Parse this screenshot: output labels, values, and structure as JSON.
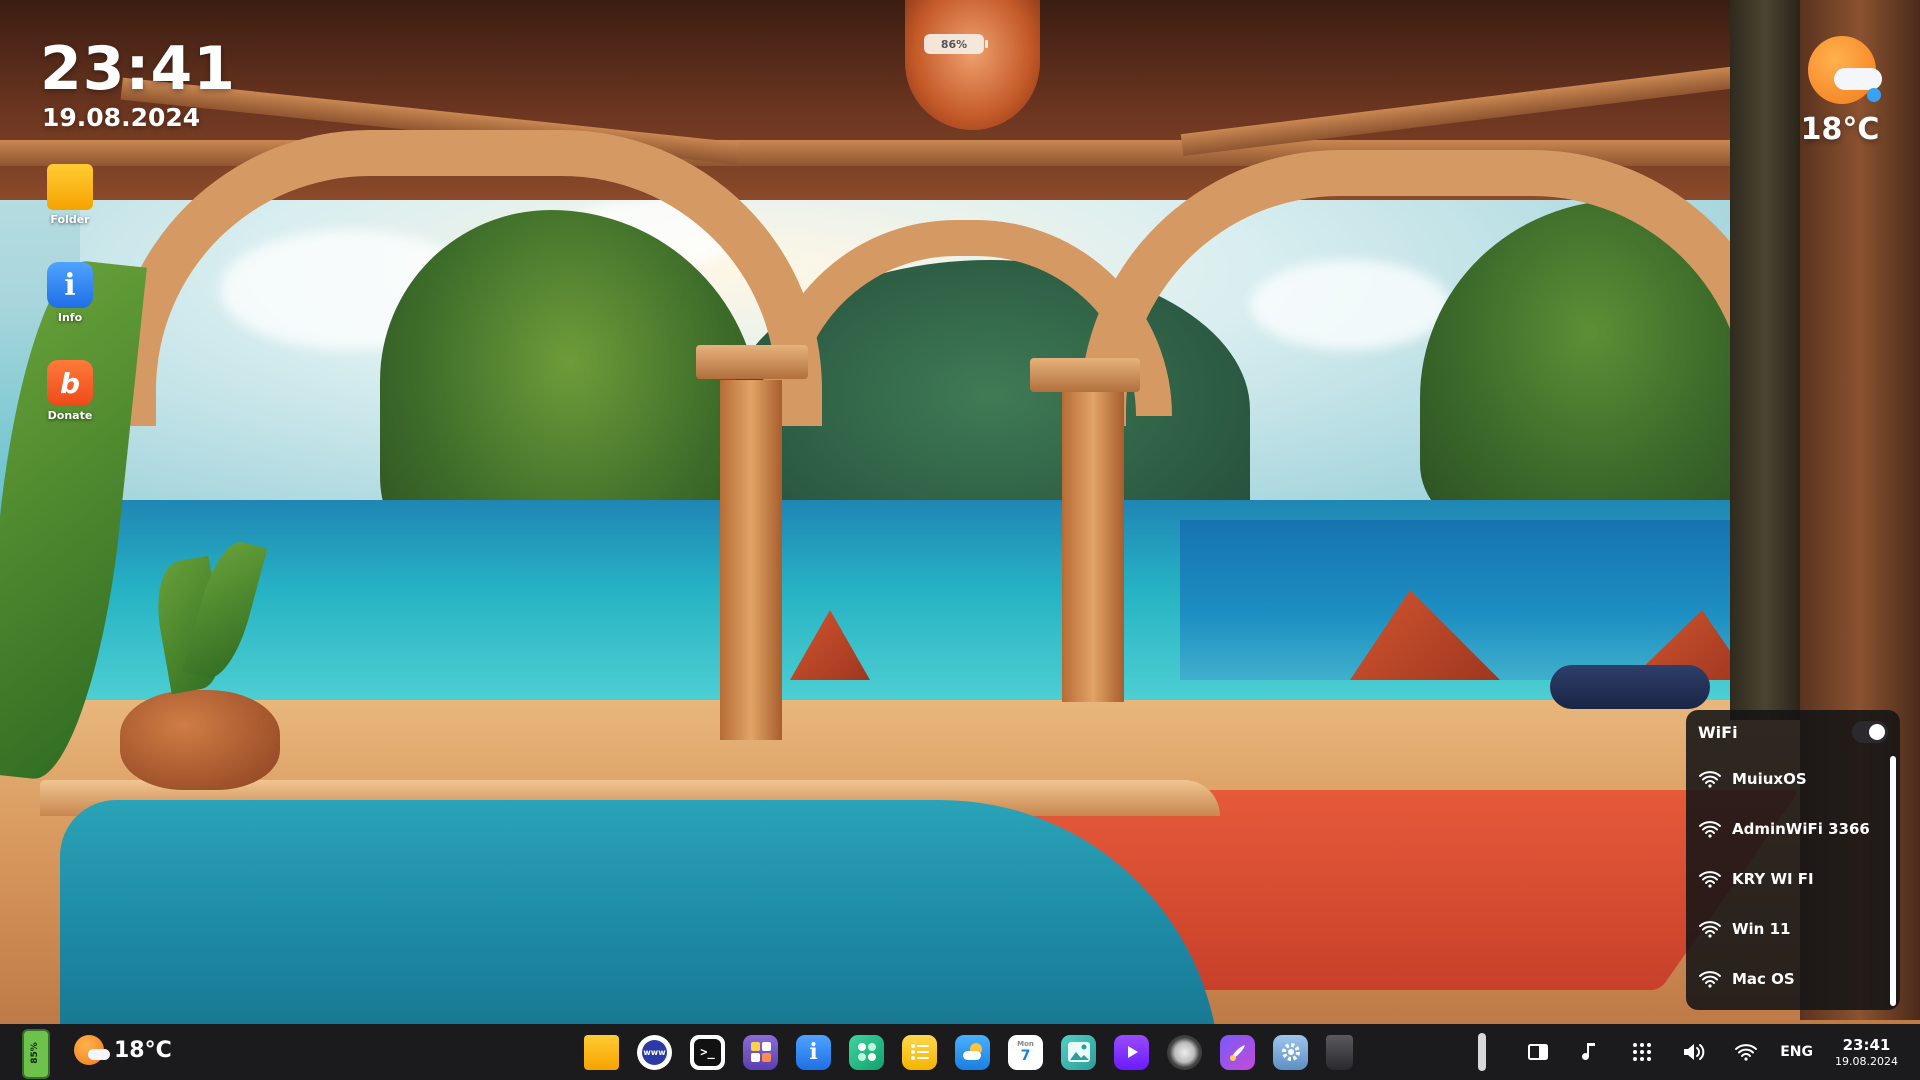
{
  "desktop": {
    "clock": {
      "time": "23:41",
      "date": "19.08.2024"
    },
    "weather": {
      "temperature": "18°C",
      "icon": "sun-cloud-icon"
    },
    "lantern_badge": "86%",
    "icons": [
      {
        "label": "Folder",
        "icon": "folder-icon"
      },
      {
        "label": "Info",
        "icon": "info-icon"
      },
      {
        "label": "Donate",
        "icon": "donate-icon"
      }
    ]
  },
  "wifi_panel": {
    "title": "WiFi",
    "enabled": true,
    "networks": [
      {
        "name": "MuiuxOS"
      },
      {
        "name": "AdminWiFi 3366"
      },
      {
        "name": "KRY WI FI"
      },
      {
        "name": "Win 11"
      },
      {
        "name": "Mac OS"
      }
    ]
  },
  "taskbar": {
    "battery_percent": "85%",
    "weather_temperature": "18°C",
    "dock_apps": [
      {
        "name": "folder",
        "icon": "folder-icon"
      },
      {
        "name": "browser",
        "icon": "www-globe-icon",
        "glyph": "www"
      },
      {
        "name": "terminal",
        "icon": "terminal-icon",
        "glyph": ">_"
      },
      {
        "name": "calculator",
        "icon": "calculator-icon"
      },
      {
        "name": "info",
        "icon": "info-icon",
        "glyph": "i"
      },
      {
        "name": "app-store",
        "icon": "apps-icon"
      },
      {
        "name": "notes",
        "icon": "notes-list-icon"
      },
      {
        "name": "weather",
        "icon": "weather-icon"
      },
      {
        "name": "calendar",
        "icon": "calendar-icon",
        "day_label": "Mon",
        "day_number": "7"
      },
      {
        "name": "photos",
        "icon": "photos-icon"
      },
      {
        "name": "video-player",
        "icon": "play-icon"
      },
      {
        "name": "camera",
        "icon": "camera-icon"
      },
      {
        "name": "paint",
        "icon": "paint-icon"
      },
      {
        "name": "settings",
        "icon": "settings-icon"
      },
      {
        "name": "trash",
        "icon": "trash-icon"
      }
    ],
    "tray": {
      "language": "ENG",
      "time": "23:41",
      "date": "19.08.2024"
    }
  },
  "colors": {
    "taskbar_bg": "#1b1b1d",
    "wifi_panel_bg": "#141416",
    "accent_orange": "#f47a1c",
    "battery_green": "#6cc24a"
  }
}
